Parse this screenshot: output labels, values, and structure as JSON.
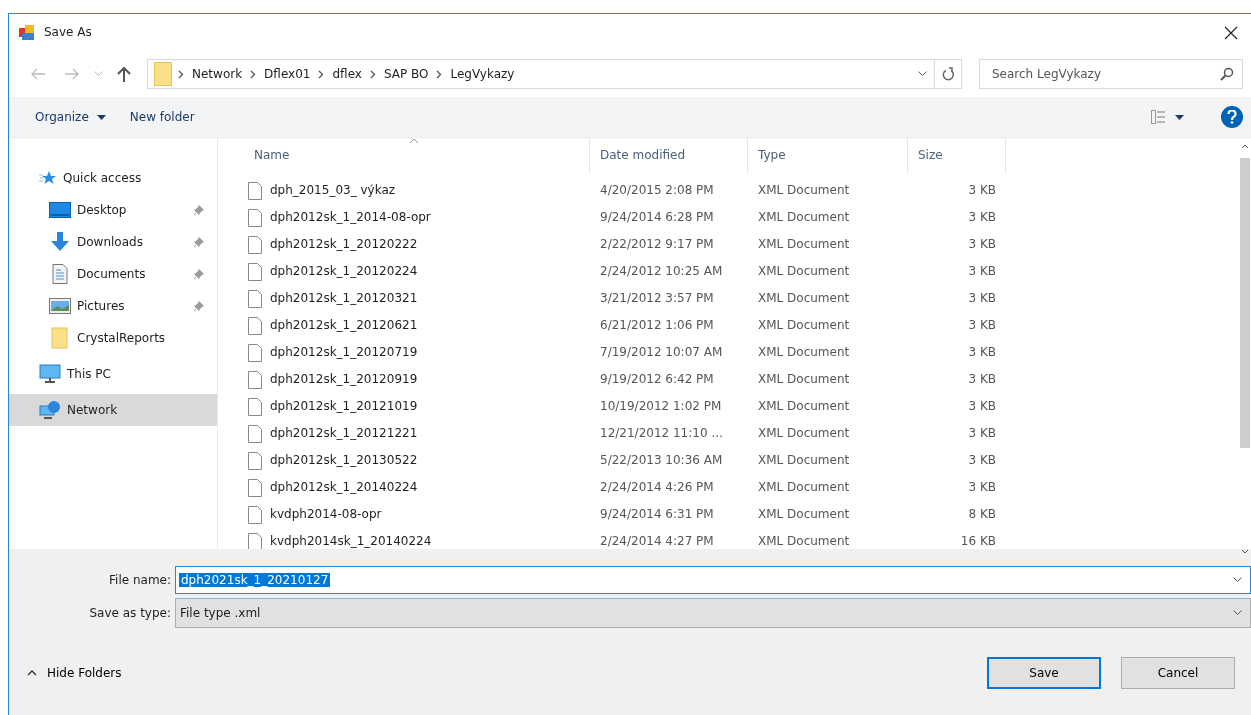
{
  "window": {
    "title": "Save As"
  },
  "address_bar": {
    "path": [
      "Network",
      "Dflex01",
      "dflex",
      "SAP BO",
      "LegVykazy"
    ]
  },
  "search": {
    "placeholder": "Search LegVykazy"
  },
  "toolbar": {
    "organize": "Organize",
    "new_folder": "New folder"
  },
  "sidebar": {
    "items": [
      {
        "label": "Quick access",
        "kind": "star",
        "pinned": false,
        "selected": false,
        "children": [
          {
            "label": "Desktop",
            "kind": "desktop",
            "pinned": true,
            "selected": false
          },
          {
            "label": "Downloads",
            "kind": "downloads",
            "pinned": true,
            "selected": false
          },
          {
            "label": "Documents",
            "kind": "documents",
            "pinned": true,
            "selected": false
          },
          {
            "label": "Pictures",
            "kind": "pictures",
            "pinned": true,
            "selected": false
          },
          {
            "label": "CrystalReports",
            "kind": "folder",
            "pinned": false,
            "selected": false
          }
        ]
      },
      {
        "label": "This PC",
        "kind": "pc",
        "pinned": false,
        "selected": false
      },
      {
        "label": "Network",
        "kind": "network",
        "pinned": false,
        "selected": true
      }
    ]
  },
  "table": {
    "columns": [
      "Name",
      "Date modified",
      "Type",
      "Size"
    ],
    "rows": [
      [
        "dph_2015_03_ výkaz",
        "4/20/2015 2:08 PM",
        "XML Document",
        "3 KB"
      ],
      [
        "dph2012sk_1_2014-08-opr",
        "9/24/2014 6:28 PM",
        "XML Document",
        "3 KB"
      ],
      [
        "dph2012sk_1_20120222",
        "2/22/2012 9:17 PM",
        "XML Document",
        "3 KB"
      ],
      [
        "dph2012sk_1_20120224",
        "2/24/2012 10:25 AM",
        "XML Document",
        "3 KB"
      ],
      [
        "dph2012sk_1_20120321",
        "3/21/2012 3:57 PM",
        "XML Document",
        "3 KB"
      ],
      [
        "dph2012sk_1_20120621",
        "6/21/2012 1:06 PM",
        "XML Document",
        "3 KB"
      ],
      [
        "dph2012sk_1_20120719",
        "7/19/2012 10:07 AM",
        "XML Document",
        "3 KB"
      ],
      [
        "dph2012sk_1_20120919",
        "9/19/2012 6:42 PM",
        "XML Document",
        "3 KB"
      ],
      [
        "dph2012sk_1_20121019",
        "10/19/2012 1:02 PM",
        "XML Document",
        "3 KB"
      ],
      [
        "dph2012sk_1_20121221",
        "12/21/2012 11:10 ...",
        "XML Document",
        "3 KB"
      ],
      [
        "dph2012sk_1_20130522",
        "5/22/2013 10:36 AM",
        "XML Document",
        "3 KB"
      ],
      [
        "dph2012sk_1_20140224",
        "2/24/2014 4:26 PM",
        "XML Document",
        "3 KB"
      ],
      [
        "kvdph2014-08-opr",
        "9/24/2014 6:31 PM",
        "XML Document",
        "8 KB"
      ],
      [
        "kvdph2014sk_1_20140224",
        "2/24/2014 4:27 PM",
        "XML Document",
        "16 KB"
      ]
    ]
  },
  "file_name": {
    "label": "File name:",
    "value": "dph2021sk_1_20210127"
  },
  "save_as_type": {
    "label": "Save as type:",
    "value": "File type .xml"
  },
  "hide_folders": "Hide Folders",
  "buttons": [
    {
      "label": "Save",
      "default": true
    },
    {
      "label": "Cancel",
      "default": false
    }
  ]
}
